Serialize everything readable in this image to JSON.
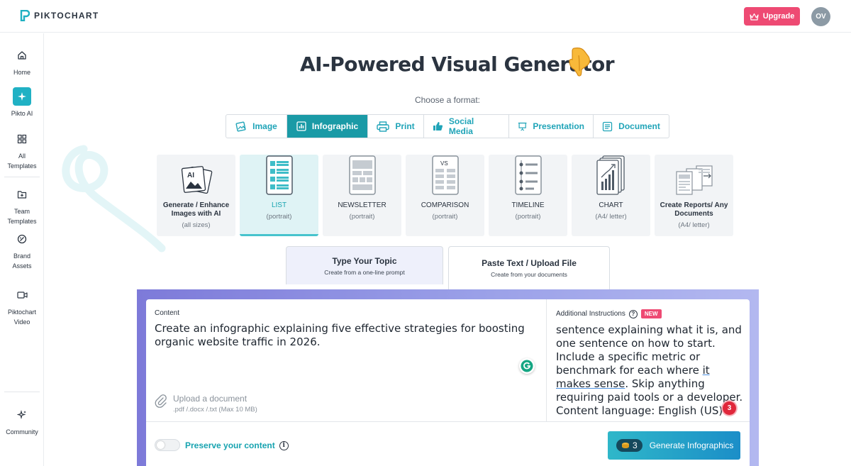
{
  "topbar": {
    "logo_text": "PIKTOCHART",
    "upgrade_label": "Upgrade",
    "avatar_initials": "OV"
  },
  "sidebar": {
    "items": [
      {
        "label": "Home",
        "icon": "home-icon"
      },
      {
        "label": "Pikto AI",
        "icon": "sparkle-icon",
        "active": true
      },
      {
        "label": "All Templates",
        "icon": "grid-icon"
      },
      {
        "label": "Team Templates",
        "icon": "folder-plus-icon"
      },
      {
        "label": "Brand Assets",
        "icon": "palette-icon"
      },
      {
        "label": "Piktochart Video",
        "icon": "video-icon"
      },
      {
        "label": "Community",
        "icon": "sparkles-icon"
      }
    ]
  },
  "main": {
    "title": "AI-Powered Visual Generator",
    "choose_label": "Choose a format:",
    "format_tabs": [
      {
        "label": "Image",
        "icon": "image-icon"
      },
      {
        "label": "Infographic",
        "icon": "bar-chart-icon",
        "active": true
      },
      {
        "label": "Print",
        "icon": "printer-icon"
      },
      {
        "label": "Social Media",
        "icon": "thumbs-up-icon"
      },
      {
        "label": "Presentation",
        "icon": "presentation-icon"
      },
      {
        "label": "Document",
        "icon": "document-icon"
      }
    ],
    "templates": [
      {
        "name": "Generate / Enhance Images with AI",
        "sub": "(all sizes)"
      },
      {
        "name": "LIST",
        "sub": "(portrait)",
        "active": true
      },
      {
        "name": "NEWSLETTER",
        "sub": "(portrait)"
      },
      {
        "name": "COMPARISON",
        "sub": "(portrait)"
      },
      {
        "name": "TIMELINE",
        "sub": "(portrait)"
      },
      {
        "name": "CHART",
        "sub": "(A4/ letter)"
      },
      {
        "name": "Create Reports/ Any Documents",
        "sub": "(A4/ letter)"
      }
    ],
    "mode_tabs": [
      {
        "title": "Type Your Topic",
        "sub": "Create from a one-line prompt"
      },
      {
        "title": "Paste Text / Upload File",
        "sub": "Create from your documents",
        "active": true
      }
    ],
    "content": {
      "label": "Content",
      "text": "Create an infographic explaining five effective strategies for boosting organic website traffic in 2026.",
      "upload_title": "Upload a document",
      "upload_sub": ".pdf /.docx /.txt (Max 10 MB)"
    },
    "instructions": {
      "label": "Additional Instructions",
      "badge": "NEW",
      "text_part1": "sentence explaining what it is, and one sentence on how to start. Include a specific metric or benchmark for each where ",
      "text_underlined": "it makes sense",
      "text_part2": ". Skip anything requiring paid tools or a developer. Content language: English (US)",
      "notification_count": "3"
    },
    "preserve_label": "Preserve your content",
    "generate": {
      "credits": "3",
      "label": "Generate Infographics"
    }
  },
  "colors": {
    "brand_teal": "#1a9aa6",
    "upgrade_pink": "#ee4a73",
    "accent_text": "#17a3b0"
  }
}
